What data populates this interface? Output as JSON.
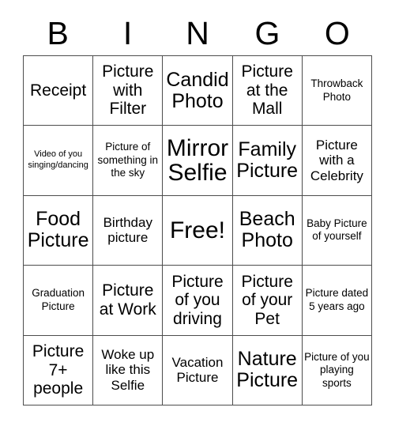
{
  "card": {
    "title": "BINGO",
    "header_letters": [
      "B",
      "I",
      "N",
      "G",
      "O"
    ],
    "rows": 5,
    "columns": 5,
    "free_space_label": "Free!",
    "free_space_position": "center",
    "border_color": "#4d4d4d",
    "text_color": "#000000",
    "background_color": "#ffffff",
    "cells": [
      {
        "text": "Receipt",
        "size": "lg",
        "column": "B",
        "row": 1,
        "free": false
      },
      {
        "text": "Picture with Filter",
        "size": "lg",
        "column": "I",
        "row": 1,
        "free": false
      },
      {
        "text": "Candid Photo",
        "size": "xl",
        "column": "N",
        "row": 1,
        "free": false
      },
      {
        "text": "Picture at the Mall",
        "size": "lg",
        "column": "G",
        "row": 1,
        "free": false
      },
      {
        "text": "Throwback Photo",
        "size": "sm",
        "column": "O",
        "row": 1,
        "free": false
      },
      {
        "text": "Video of you singing/dancing",
        "size": "xs",
        "column": "B",
        "row": 2,
        "free": false
      },
      {
        "text": "Picture of something in the sky",
        "size": "sm",
        "column": "I",
        "row": 2,
        "free": false
      },
      {
        "text": "Mirror Selfie",
        "size": "xxl",
        "column": "N",
        "row": 2,
        "free": false
      },
      {
        "text": "Family Picture",
        "size": "xl",
        "column": "G",
        "row": 2,
        "free": false
      },
      {
        "text": "Picture with a Celebrity",
        "size": "md",
        "column": "O",
        "row": 2,
        "free": false
      },
      {
        "text": "Food Picture",
        "size": "xl",
        "column": "B",
        "row": 3,
        "free": false
      },
      {
        "text": "Birthday picture",
        "size": "md",
        "column": "I",
        "row": 3,
        "free": false
      },
      {
        "text": "Free!",
        "size": "xxl",
        "column": "N",
        "row": 3,
        "free": true
      },
      {
        "text": "Beach Photo",
        "size": "xl",
        "column": "G",
        "row": 3,
        "free": false
      },
      {
        "text": "Baby Picture of yourself",
        "size": "sm",
        "column": "O",
        "row": 3,
        "free": false
      },
      {
        "text": "Graduation Picture",
        "size": "sm",
        "column": "B",
        "row": 4,
        "free": false
      },
      {
        "text": "Picture at Work",
        "size": "lg",
        "column": "I",
        "row": 4,
        "free": false
      },
      {
        "text": "Picture of you driving",
        "size": "lg",
        "column": "N",
        "row": 4,
        "free": false
      },
      {
        "text": "Picture of your Pet",
        "size": "lg",
        "column": "G",
        "row": 4,
        "free": false
      },
      {
        "text": "Picture dated 5 years ago",
        "size": "sm",
        "column": "O",
        "row": 4,
        "free": false
      },
      {
        "text": "Picture 7+ people",
        "size": "lg",
        "column": "B",
        "row": 5,
        "free": false
      },
      {
        "text": "Woke up like this Selfie",
        "size": "md",
        "column": "I",
        "row": 5,
        "free": false
      },
      {
        "text": "Vacation Picture",
        "size": "md",
        "column": "N",
        "row": 5,
        "free": false
      },
      {
        "text": "Nature Picture",
        "size": "xl",
        "column": "G",
        "row": 5,
        "free": false
      },
      {
        "text": "Picture of you playing sports",
        "size": "sm",
        "column": "O",
        "row": 5,
        "free": false
      }
    ]
  }
}
